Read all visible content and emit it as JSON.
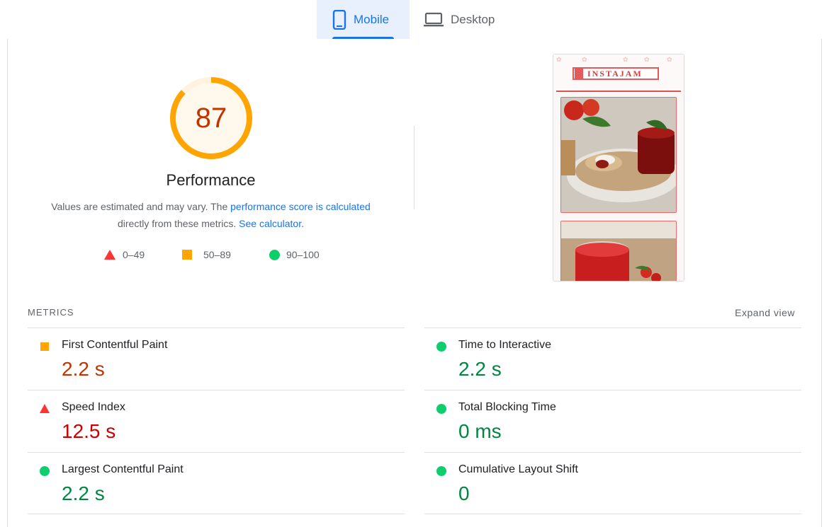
{
  "tabs": {
    "mobile": {
      "label": "Mobile",
      "icon": "smartphone-icon",
      "active": true
    },
    "desktop": {
      "label": "Desktop",
      "icon": "laptop-icon",
      "active": false
    }
  },
  "summary": {
    "score": "87",
    "score_fraction": 0.87,
    "score_color": "#ffa400",
    "title": "Performance",
    "desc_prefix": "Values are estimated and may vary. The ",
    "desc_link1": "performance score is calculated",
    "desc_middle": "directly from these metrics. ",
    "desc_link2": "See calculator",
    "desc_suffix": "."
  },
  "legend": [
    {
      "icon": "triangle-icon",
      "label": "0–49",
      "color": "#ff3333"
    },
    {
      "icon": "square-icon",
      "label": "50–89",
      "color": "#ffa400"
    },
    {
      "icon": "circle-icon",
      "label": "90–100",
      "color": "#0cce6b"
    }
  ],
  "screenshot": {
    "logo_text": "INSTAJAM",
    "alt": "final-screenshot"
  },
  "metrics": {
    "header": "METRICS",
    "expand_label": "Expand view",
    "left": [
      {
        "name": "First Contentful Paint",
        "value": "2.2 s",
        "rating": "average"
      },
      {
        "name": "Speed Index",
        "value": "12.5 s",
        "rating": "fail"
      },
      {
        "name": "Largest Contentful Paint",
        "value": "2.2 s",
        "rating": "pass"
      }
    ],
    "right": [
      {
        "name": "Time to Interactive",
        "value": "2.2 s",
        "rating": "pass"
      },
      {
        "name": "Total Blocking Time",
        "value": "0 ms",
        "rating": "pass"
      },
      {
        "name": "Cumulative Layout Shift",
        "value": "0",
        "rating": "pass"
      }
    ]
  },
  "colors": {
    "accent": "#1a73e8",
    "fail": "#cc0000",
    "average": "#c33300",
    "pass": "#018642"
  }
}
